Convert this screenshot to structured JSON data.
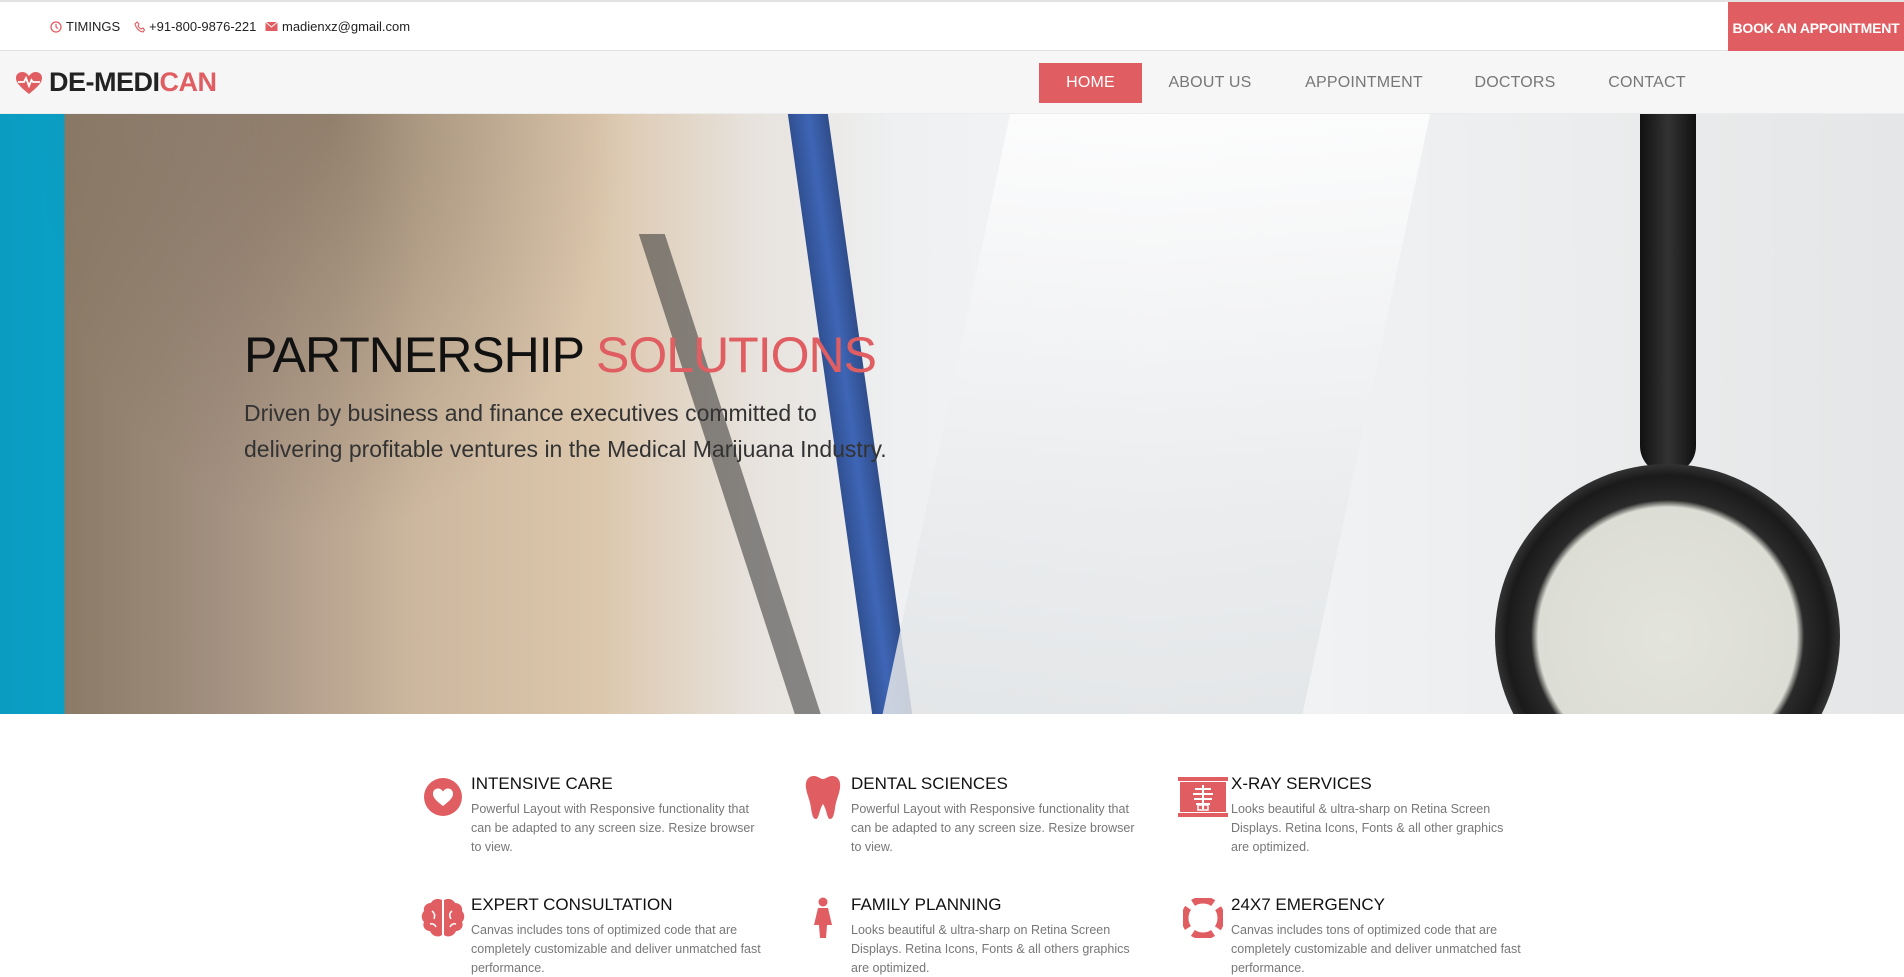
{
  "topbar": {
    "timings": "TIMINGS",
    "phone": "+91-800-9876-221",
    "email": "madienxz@gmail.com",
    "book_button": "BOOK AN APPOINTMENT",
    "accent_color": "#e05d61"
  },
  "logo": {
    "text_main": "DE-MEDI",
    "text_accent": "CAN",
    "icon": "heartbeat-icon"
  },
  "nav": {
    "items": [
      {
        "label": "HOME",
        "active": true
      },
      {
        "label": "ABOUT US",
        "active": false
      },
      {
        "label": "APPOINTMENT",
        "active": false
      },
      {
        "label": "DOCTORS",
        "active": false
      },
      {
        "label": "CONTACT",
        "active": false
      }
    ]
  },
  "hero": {
    "title_main": "PARTNERSHIP",
    "title_accent": "SOLUTIONS",
    "subtitle": "Driven by business and finance executives committed to delivering profitable ventures in the Medical Marijuana Industry."
  },
  "services": [
    {
      "title": "INTENSIVE CARE",
      "icon": "heart-circle-icon",
      "desc": "Powerful Layout with Responsive functionality that can be adapted to any screen size. Resize browser to view."
    },
    {
      "title": "DENTAL SCIENCES",
      "icon": "tooth-icon",
      "desc": "Powerful Layout with Responsive functionality that can be adapted to any screen size. Resize browser to view."
    },
    {
      "title": "X-RAY SERVICES",
      "icon": "xray-icon",
      "desc": "Looks beautiful & ultra-sharp on Retina Screen Displays. Retina Icons, Fonts & all other graphics are optimized."
    },
    {
      "title": "EXPERT CONSULTATION",
      "icon": "brain-icon",
      "desc": "Canvas includes tons of optimized code that are completely customizable and deliver unmatched fast performance."
    },
    {
      "title": "FAMILY PLANNING",
      "icon": "woman-icon",
      "desc": "Looks beautiful & ultra-sharp on Retina Screen Displays. Retina Icons, Fonts & all others graphics are optimized."
    },
    {
      "title": "24X7 EMERGENCY",
      "icon": "lifebuoy-icon",
      "desc": "Canvas includes tons of optimized code that are completely customizable and deliver unmatched fast performance."
    }
  ]
}
